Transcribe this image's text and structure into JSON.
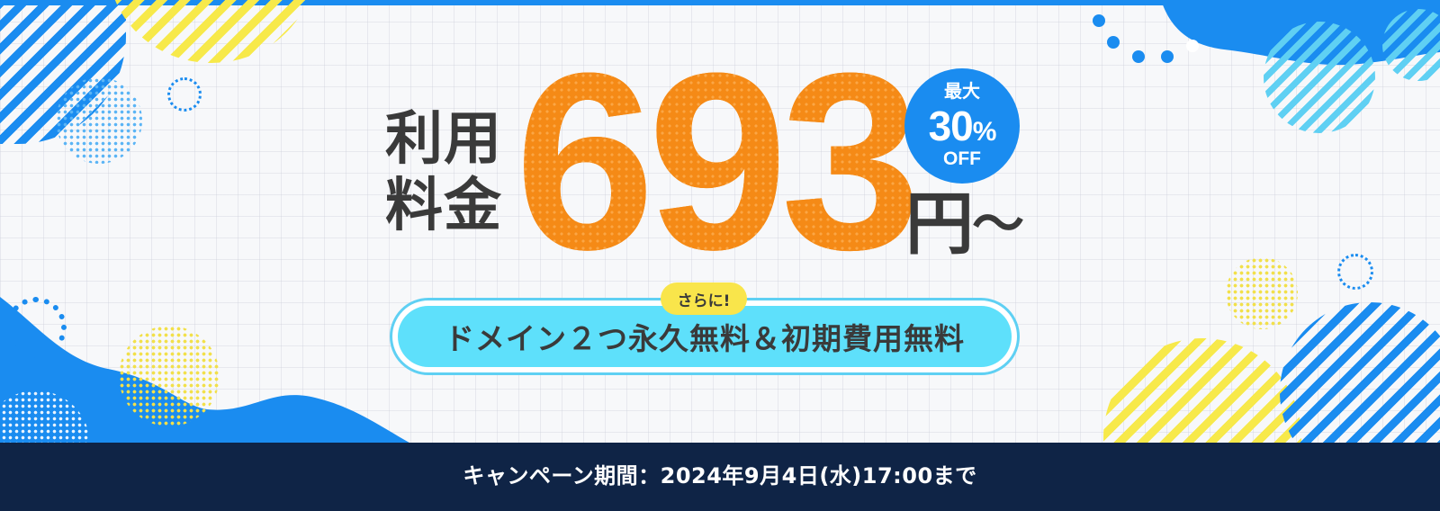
{
  "banner": {
    "label_line1": "利用",
    "label_line2": "料金",
    "price": "693",
    "currency": "円",
    "suffix": "〜",
    "discount": {
      "line1": "最大",
      "percent": "30",
      "percent_sign": "%",
      "line3": "OFF"
    },
    "tag": "さらに!",
    "offer": "ドメイン２つ永久無料＆初期費用無料",
    "campaign_period": "キャンペーン期間：2024年9月4日(水)17:00まで"
  },
  "colors": {
    "accent_orange": "#f58a16",
    "accent_blue": "#1a8cf0",
    "pill_cyan": "#5ee0fb",
    "tag_yellow": "#f9e54b",
    "footer_navy": "#0f2446",
    "text_dark": "#3a3a3a"
  },
  "icons": [
    "dotted-ring-icon",
    "stripe-circle-icon",
    "dot-pattern-circle-icon",
    "blue-blob-shape"
  ]
}
